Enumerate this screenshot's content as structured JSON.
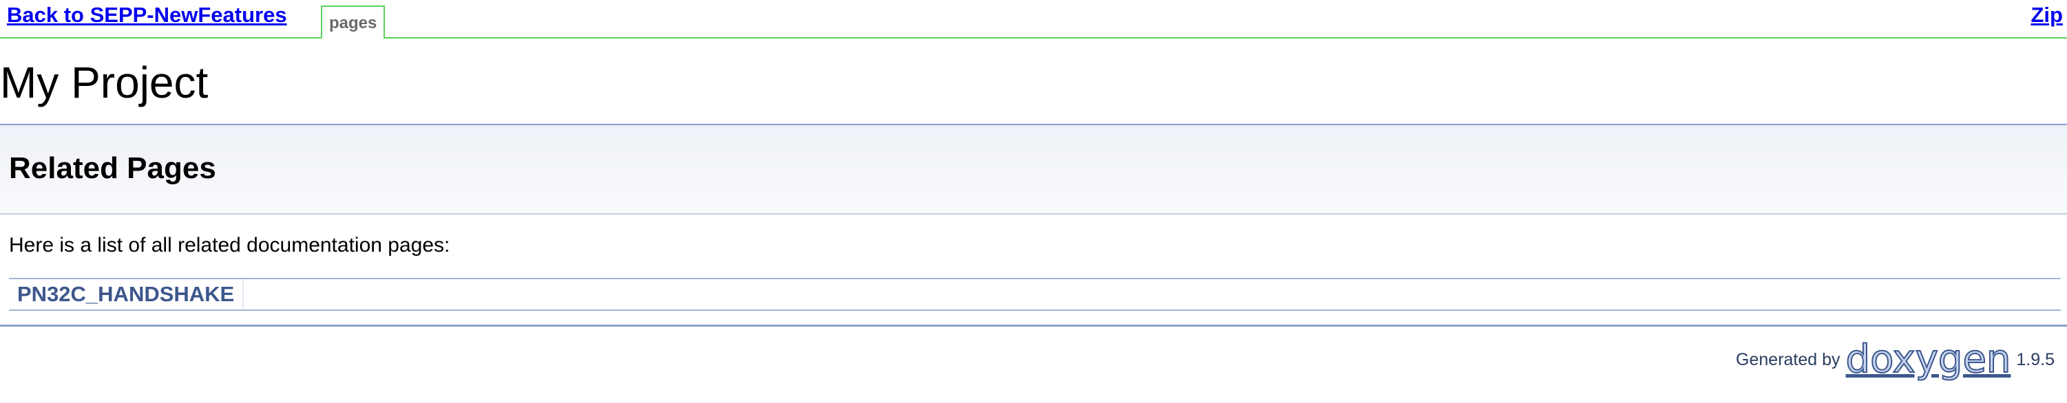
{
  "nav": {
    "back_label": "Back to SEPP-NewFeatures",
    "tab_label": "pages",
    "zip_label": "Zip"
  },
  "project_title": "My Project",
  "header": {
    "title": "Related Pages"
  },
  "intro": "Here is a list of all related documentation pages:",
  "pages": [
    {
      "label": "PN32C_HANDSHAKE"
    }
  ],
  "footer": {
    "generated_by": "Generated by",
    "logo_text": "doxygen",
    "version": "1.9.5"
  },
  "colors": {
    "accent_green": "#5ad25a",
    "link_blue": "#0000ee",
    "doxygen_blue": "#3d578c"
  }
}
